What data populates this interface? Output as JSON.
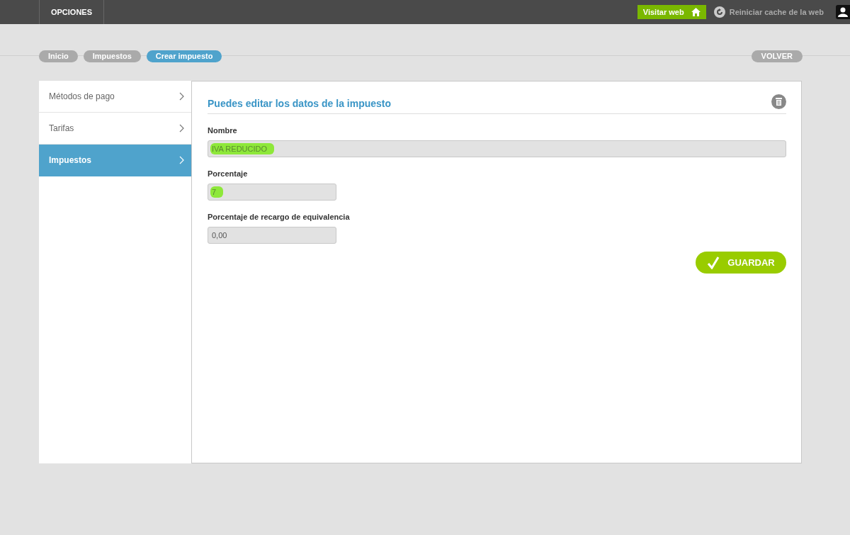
{
  "topbar": {
    "menu_label": "OPCIONES",
    "visit_button": "Visitar web",
    "cache_link": "Reiniciar cache de la web"
  },
  "breadcrumbs": [
    {
      "label": "Inicio",
      "selected": false
    },
    {
      "label": "Impuestos",
      "selected": false
    },
    {
      "label": "Crear impuesto",
      "selected": true
    }
  ],
  "back_button": "VOLVER",
  "sidebar": {
    "items": [
      {
        "label": "Métodos de pago",
        "selected": false
      },
      {
        "label": "Tarifas",
        "selected": false
      },
      {
        "label": "Impuestos",
        "selected": true
      }
    ]
  },
  "form": {
    "title": "Puedes editar los datos de la impuesto",
    "fields": [
      {
        "label": "Nombre",
        "value": "IVA REDUCIDO",
        "kind": "wide",
        "highlighted": true
      },
      {
        "label": "Porcentaje",
        "value": "7",
        "kind": "narrow",
        "highlighted": true
      },
      {
        "label": "Porcentaje de recargo de equivalencia",
        "value": "0,00",
        "kind": "narrow",
        "highlighted": false
      }
    ],
    "save_button": "GUARDAR"
  }
}
